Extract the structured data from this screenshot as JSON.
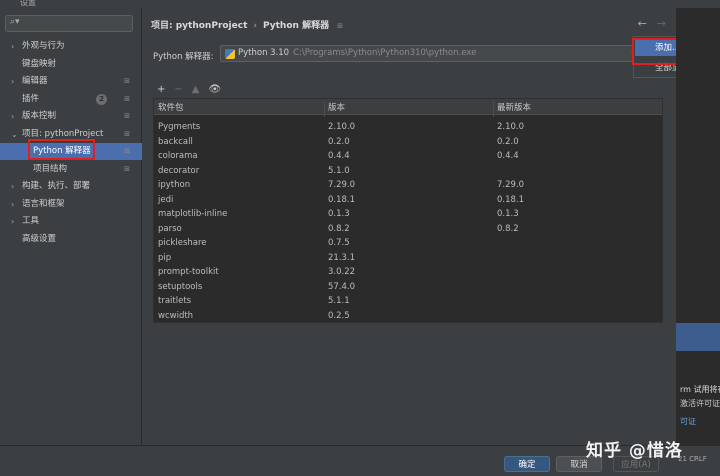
{
  "window": {
    "title": "设置"
  },
  "sidebar": {
    "search_placeholder": "",
    "items": [
      {
        "label": "外观与行为",
        "arrow": "›"
      },
      {
        "label": "键盘映射",
        "arrow": ""
      },
      {
        "label": "编辑器",
        "arrow": "›"
      },
      {
        "label": "插件",
        "arrow": "",
        "badge": "2"
      },
      {
        "label": "版本控制",
        "arrow": "›"
      },
      {
        "label": "项目: pythonProject",
        "arrow": "⌄"
      },
      {
        "label": "Python 解释器",
        "arrow": "",
        "selected": true
      },
      {
        "label": "项目结构",
        "arrow": ""
      },
      {
        "label": "构建、执行、部署",
        "arrow": "›"
      },
      {
        "label": "语言和框架",
        "arrow": "›"
      },
      {
        "label": "工具",
        "arrow": "›"
      },
      {
        "label": "高级设置",
        "arrow": ""
      }
    ],
    "help": "?"
  },
  "header": {
    "crumb_project": "项目: pythonProject",
    "crumb_sep": "›",
    "crumb_page": "Python 解释器",
    "pin": "⊞"
  },
  "nav": {
    "back": "←",
    "forward": "→"
  },
  "interpreter": {
    "label": "Python 解释器:",
    "name": "Python 3.10",
    "path": "C:\\Programs\\Python\\Python310\\python.exe",
    "dropdown": "▾"
  },
  "toolbar": {
    "add": "+",
    "remove": "−",
    "up": "▲",
    "show": "👁"
  },
  "table": {
    "headers": [
      "软件包",
      "版本",
      "最新版本"
    ],
    "rows": [
      [
        "Pygments",
        "2.10.0",
        "2.10.0"
      ],
      [
        "backcall",
        "0.2.0",
        "0.2.0"
      ],
      [
        "colorama",
        "0.4.4",
        "0.4.4"
      ],
      [
        "decorator",
        "5.1.0",
        ""
      ],
      [
        "ipython",
        "7.29.0",
        "7.29.0"
      ],
      [
        "jedi",
        "0.18.1",
        "0.18.1"
      ],
      [
        "matplotlib-inline",
        "0.1.3",
        "0.1.3"
      ],
      [
        "parso",
        "0.8.2",
        "0.8.2"
      ],
      [
        "pickleshare",
        "0.7.5",
        ""
      ],
      [
        "pip",
        "21.3.1",
        ""
      ],
      [
        "prompt-toolkit",
        "3.0.22",
        ""
      ],
      [
        "setuptools",
        "57.4.0",
        ""
      ],
      [
        "traitlets",
        "5.1.1",
        ""
      ],
      [
        "wcwidth",
        "0.2.5",
        ""
      ]
    ]
  },
  "popup": {
    "add": "添加...",
    "show_all": "全部显示..."
  },
  "right_strip": {
    "t1": "rm 试用将在",
    "t2": "激活许可证。",
    "t3": "可证"
  },
  "buttons": {
    "ok": "确定",
    "cancel": "取消",
    "apply": "应用(A)"
  },
  "watermark": "知乎 @惜洛",
  "status": "21  CRLF"
}
